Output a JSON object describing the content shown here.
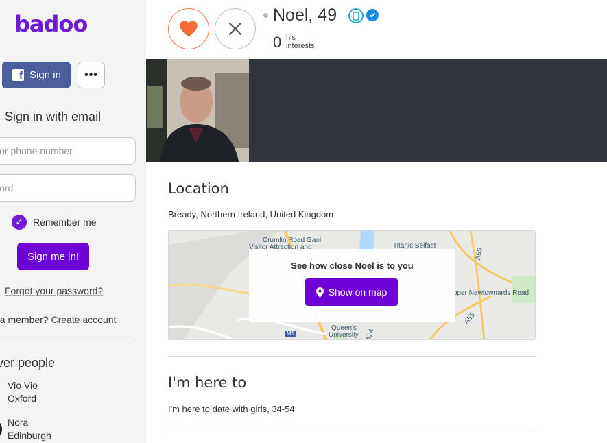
{
  "sidebar": {
    "logo": "badoo",
    "facebook_label": "Sign in",
    "more_label": "•••",
    "signin_title": "Sign in with email",
    "email_placeholder": "il or phone number",
    "password_placeholder": "word",
    "remember_label": "Remember me",
    "signin_button": "Sign me in!",
    "forgot_link": "Forgot your password?",
    "member_prefix": "t a member?",
    "create_account": "Create account",
    "discover_title": "over people",
    "people": [
      {
        "name": "Vio Vio",
        "city": "Oxford"
      },
      {
        "name": "Nora",
        "city": "Edinburgh"
      }
    ]
  },
  "profile": {
    "name": "Noel, 49",
    "interests_count": "0",
    "interests_label_line1": "his",
    "interests_label_line2": "interests"
  },
  "location": {
    "title": "Location",
    "text": "Bready, Northern Ireland, United Kingdom",
    "map_card_title": "See how close Noel is to you",
    "map_button": "Show on map",
    "map_labels": {
      "crumlin": "Crumlin Road Gaol",
      "visitor": "Visitor Attraction and",
      "titanic": "Titanic Belfast",
      "newtownards": "pper Newtownards Road",
      "queens": "Queen's",
      "university": "University",
      "a55": "A55",
      "a55b": "A55",
      "a24": "A24",
      "m1": "M1"
    }
  },
  "here_to": {
    "title": "I'm here to",
    "text": "I'm here to date with girls, 34-54"
  },
  "colors": {
    "brand": "#6e1ad6",
    "button_purple": "#6e00d8",
    "like_orange": "#f26b38",
    "facebook_blue": "#4b5f9c"
  }
}
